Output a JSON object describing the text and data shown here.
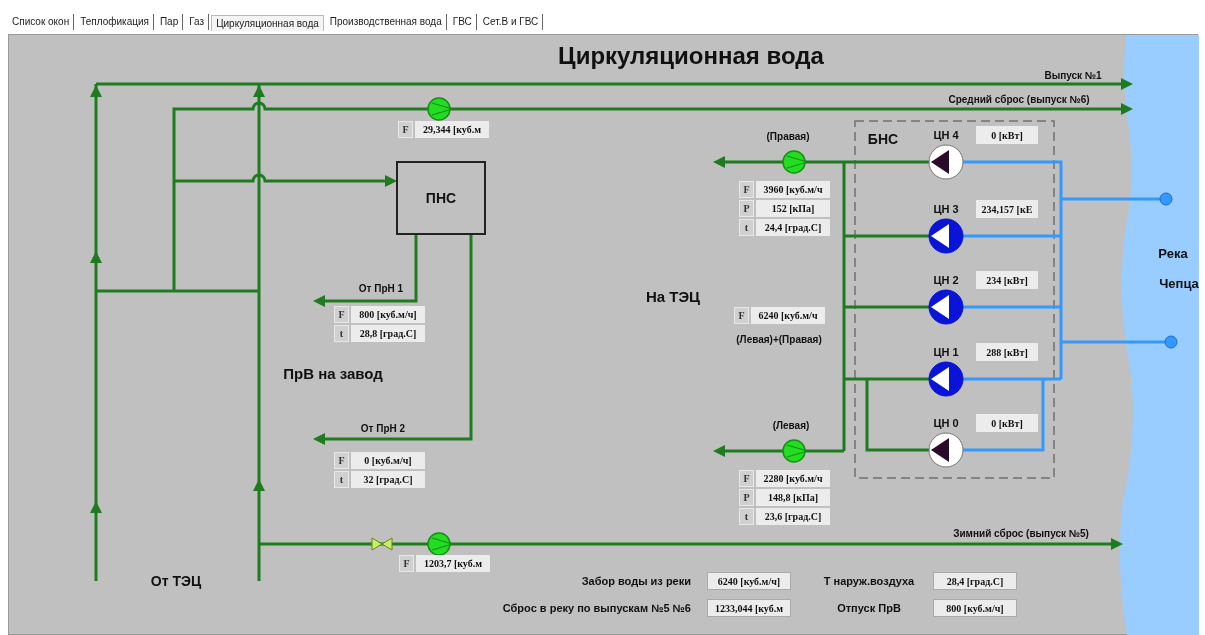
{
  "tabs": [
    {
      "label": "Список окон",
      "selected": false
    },
    {
      "label": "Теплофикация",
      "selected": false
    },
    {
      "label": "Пар",
      "selected": false
    },
    {
      "label": "Газ",
      "selected": false
    },
    {
      "label": "Циркуляционная вода",
      "selected": true
    },
    {
      "label": "Производственная вода",
      "selected": false
    },
    {
      "label": "ГВС",
      "selected": false
    },
    {
      "label": "Сет.В и ГВС",
      "selected": false
    }
  ],
  "title": "Циркуляционная вода",
  "outlet_1_label": "Выпуск №1",
  "outlet_6_label": "Средний сброс (выпуск №6)",
  "outlet_5_label": "Зимний сброс (выпуск №5)",
  "pns_label": "ПНС",
  "bns_label": "БНС",
  "river_label": [
    "Река",
    "Чепца"
  ],
  "from_tec_label": "От ТЭЦ",
  "to_tec_label": "На ТЭЦ",
  "to_plant_label": "ПрВ на завод",
  "from_prn1_label": "От ПрН 1",
  "from_prn2_label": "От ПрН 2",
  "right_label": "(Правая)",
  "left_label": "(Левая)",
  "sum_label": "(Левая)+(Правая)",
  "readouts": {
    "pns_top": [
      {
        "param": "F",
        "value": "29,344 [куб.м"
      }
    ],
    "prn1": [
      {
        "param": "F",
        "value": "800 [куб.м/ч]"
      },
      {
        "param": "t",
        "value": "28,8 [град.С]"
      }
    ],
    "prn2": [
      {
        "param": "F",
        "value": "0 [куб.м/ч]"
      },
      {
        "param": "t",
        "value": "32 [град.С]"
      }
    ],
    "right": [
      {
        "param": "F",
        "value": "3960 [куб.м/ч"
      },
      {
        "param": "P",
        "value": "152 [кПа]"
      },
      {
        "param": "t",
        "value": "24,4 [град.С]"
      }
    ],
    "sum": [
      {
        "param": "F",
        "value": "6240 [куб.м/ч"
      }
    ],
    "left": [
      {
        "param": "F",
        "value": "2280 [куб.м/ч"
      },
      {
        "param": "P",
        "value": "148,8 [кПа]"
      },
      {
        "param": "t",
        "value": "23,6 [град.С]"
      }
    ],
    "winter": [
      {
        "param": "F",
        "value": "1203,7 [куб.м"
      }
    ]
  },
  "pumps": [
    {
      "name": "ЦН 4",
      "power": "0 [кВт]",
      "on": false
    },
    {
      "name": "ЦН 3",
      "power": "234,157 [кЕ",
      "on": true
    },
    {
      "name": "ЦН 2",
      "power": "234 [кВт]",
      "on": true
    },
    {
      "name": "ЦН 1",
      "power": "288 [кВт]",
      "on": true
    },
    {
      "name": "ЦН 0",
      "power": "0 [кВт]",
      "on": false
    }
  ],
  "summary": [
    {
      "label": "Забор воды из реки",
      "value": "6240 [куб.м/ч]"
    },
    {
      "label": "Сброс в реку по выпускам №5 №6",
      "value": "1233,044 [куб.м"
    },
    {
      "label": "Т наруж.воздуха",
      "value": "28,4 [град.С]"
    },
    {
      "label": "Отпуск ПрВ",
      "value": "800 [куб.м/ч]"
    }
  ]
}
